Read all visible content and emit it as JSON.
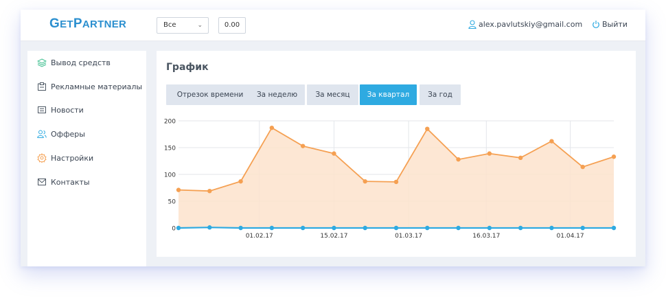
{
  "app": {
    "logo_big_g": "G",
    "logo_et": "ET",
    "logo_big_p": "P",
    "logo_artner": "ARTNER"
  },
  "header": {
    "filter_select_value": "Все",
    "amount_value": "0.00",
    "user_email": "alex.pavlutskiy@gmail.com",
    "logout_label": "Выйти"
  },
  "sidebar": {
    "items": [
      {
        "label": "Вывод средств",
        "icon": "layers-icon"
      },
      {
        "label": "Рекламные материалы",
        "icon": "clipboard-icon"
      },
      {
        "label": "Новости",
        "icon": "news-icon"
      },
      {
        "label": "Офферы",
        "icon": "users-icon"
      },
      {
        "label": "Настройки",
        "icon": "gear-icon"
      },
      {
        "label": "Контакты",
        "icon": "mail-icon"
      }
    ]
  },
  "main": {
    "title": "График",
    "tabs": [
      {
        "label": "Отрезок времени",
        "active": false
      },
      {
        "label": "За неделю",
        "active": false
      },
      {
        "label": "За месяц",
        "active": false
      },
      {
        "label": "За квартал",
        "active": true
      },
      {
        "label": "За год",
        "active": false
      }
    ]
  },
  "colors": {
    "brand": "#2b8fcf",
    "active_tab": "#2eaae1",
    "orange_series": "#f5a052",
    "orange_fill": "#fde3cc",
    "blue_series": "#2eaae1"
  },
  "chart_data": {
    "type": "area",
    "ylim": [
      0,
      200
    ],
    "y_ticks": [
      0,
      50,
      100,
      150,
      200
    ],
    "x_tick_labels": [
      "01.02.17",
      "15.02.17",
      "01.03.17",
      "16.03.17",
      "01.04.17"
    ],
    "x_tick_index": [
      2.6,
      5.0,
      7.4,
      9.9,
      12.6
    ],
    "grid": true,
    "series": [
      {
        "color": "#f5a052",
        "values": [
          71,
          69,
          87,
          187,
          153,
          139,
          87,
          86,
          185,
          128,
          139,
          131,
          162,
          114,
          133
        ]
      },
      {
        "color": "#2eaae1",
        "values": [
          0,
          1,
          0,
          0,
          0,
          0,
          0,
          0,
          0,
          0,
          0,
          0,
          0,
          0,
          0
        ]
      }
    ]
  }
}
